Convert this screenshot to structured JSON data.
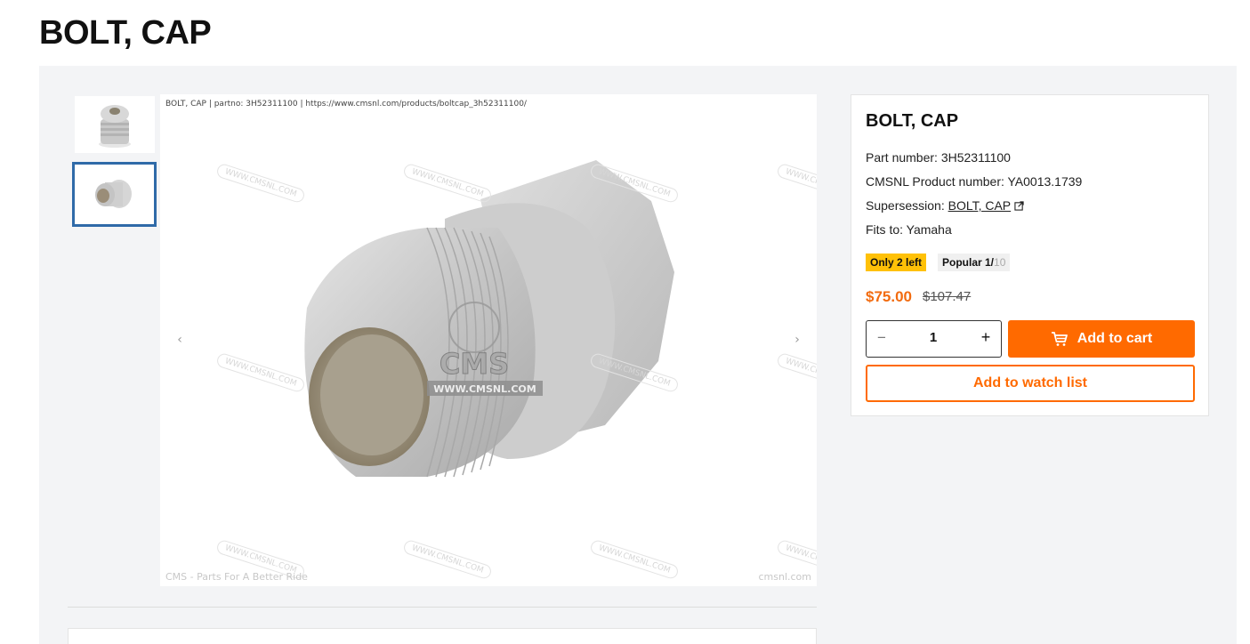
{
  "page": {
    "title": "BOLT, CAP"
  },
  "gallery": {
    "thumbnails": [
      {
        "alt": "BOLT, CAP image 1",
        "selected": false
      },
      {
        "alt": "BOLT, CAP image 2",
        "selected": true
      }
    ],
    "caption": "BOLT, CAP | partno: 3H52311100  | https://www.cmsnl.com/products/boltcap_3h52311100/",
    "footer_left": "CMS - Parts For A Better Ride",
    "footer_right": "cmsnl.com",
    "watermark_text": "WWW.CMSNL.COM",
    "logo_text": "CMS",
    "logo_subtext": "WWW.CMSNL.COM",
    "prev_icon": "chevron-left-icon",
    "next_icon": "chevron-right-icon"
  },
  "product": {
    "title": "BOLT, CAP",
    "part_number_label": "Part number: 3H52311100",
    "cmsnl_label": "CMSNL Product number: YA0013.1739",
    "supersession_prefix": "Supersession: ",
    "supersession_link": "BOLT, CAP",
    "fits_to": "Fits to: Yamaha",
    "badge_stock": "Only 2 left",
    "badge_popular_prefix": "Popular 1/",
    "badge_popular_total": "10",
    "price_current": "$75.00",
    "price_old": "$107.47",
    "quantity": "1",
    "qty_minus": "−",
    "qty_plus": "+",
    "add_to_cart": "Add to cart",
    "add_to_watch": "Add to watch list"
  },
  "colors": {
    "accent": "#ff6a00",
    "price": "#f26b0f",
    "stock_badge": "#ffc107",
    "thumb_selected_border": "#2f6aa8",
    "panel_bg": "#f3f4f6"
  }
}
